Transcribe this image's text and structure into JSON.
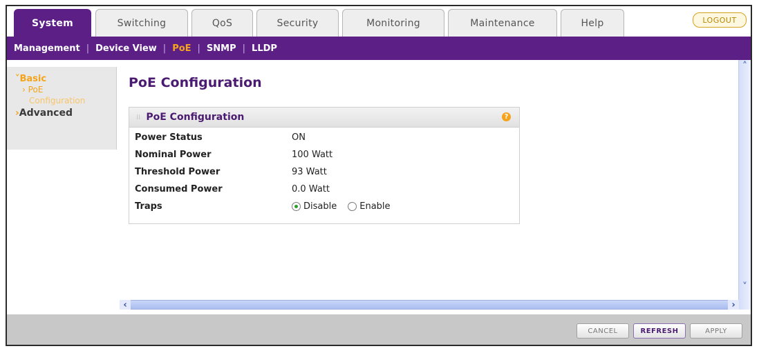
{
  "tabs": [
    {
      "label": "System",
      "active": true
    },
    {
      "label": "Switching"
    },
    {
      "label": "QoS"
    },
    {
      "label": "Security"
    },
    {
      "label": "Monitoring"
    },
    {
      "label": "Maintenance"
    },
    {
      "label": "Help"
    }
  ],
  "logout_label": "LOGOUT",
  "subnav": [
    "Management",
    "Device View",
    "PoE",
    "SNMP",
    "LLDP"
  ],
  "subnav_active": "PoE",
  "leftnav": {
    "basic": "Basic",
    "poe": "PoE",
    "configuration": "Configuration",
    "advanced": "Advanced"
  },
  "page_title": "PoE Configuration",
  "panel": {
    "title": "PoE Configuration",
    "rows": [
      {
        "label": "Power Status",
        "value": "ON"
      },
      {
        "label": "Nominal Power",
        "value": "100 Watt"
      },
      {
        "label": "Threshold Power",
        "value": "93 Watt"
      },
      {
        "label": "Consumed Power",
        "value": "0.0 Watt"
      }
    ],
    "traps_label": "Traps",
    "traps_options": [
      "Disable",
      "Enable"
    ],
    "traps_selected": "Disable"
  },
  "footer": {
    "cancel": "CANCEL",
    "refresh": "REFRESH",
    "apply": "APPLY"
  },
  "colors": {
    "brand_purple": "#5b1f86",
    "accent_orange": "#f3a41a"
  }
}
